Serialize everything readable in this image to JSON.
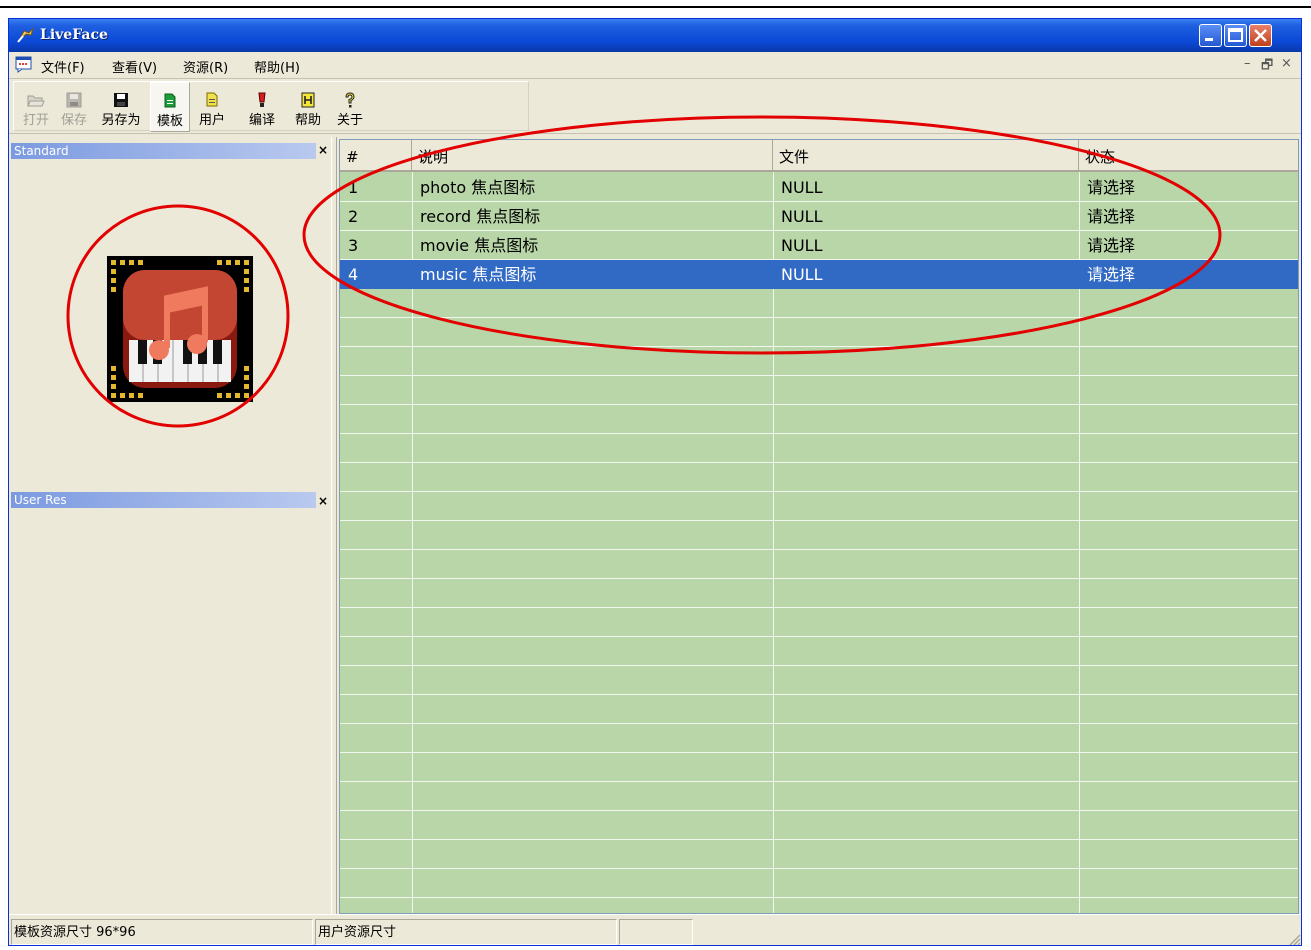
{
  "window": {
    "title": "LiveFace"
  },
  "menu": {
    "items": [
      "文件(F)",
      "查看(V)",
      "资源(R)",
      "帮助(H)"
    ]
  },
  "mdi": {
    "min": "–",
    "restore": "🗗",
    "close": "×"
  },
  "toolbar": {
    "buttons": [
      {
        "label": "打开",
        "icon": "open-folder-icon",
        "enabled": false
      },
      {
        "label": "保存",
        "icon": "save-disk-icon",
        "enabled": false
      },
      {
        "label": "另存为",
        "icon": "save-as-disk-icon",
        "enabled": true
      },
      {
        "label": "模板",
        "icon": "template-page-icon",
        "enabled": true,
        "pressed": true
      },
      {
        "label": "用户",
        "icon": "user-page-icon",
        "enabled": true
      },
      {
        "label": "编译",
        "icon": "compile-icon",
        "enabled": true
      },
      {
        "label": "帮助",
        "icon": "help-book-icon",
        "enabled": true
      },
      {
        "label": "关于",
        "icon": "about-question-icon",
        "enabled": true
      }
    ]
  },
  "panels": {
    "standard": {
      "title": "Standard",
      "close": "×"
    },
    "user_res": {
      "title": "User Res",
      "close": "×"
    }
  },
  "table": {
    "headers": [
      "#",
      "说明",
      "文件",
      "状态"
    ],
    "rows": [
      {
        "num": "1",
        "desc": "photo 焦点图标",
        "file": "NULL",
        "status": "请选择"
      },
      {
        "num": "2",
        "desc": "record 焦点图标",
        "file": "NULL",
        "status": "请选择"
      },
      {
        "num": "3",
        "desc": "movie 焦点图标",
        "file": "NULL",
        "status": "请选择"
      },
      {
        "num": "4",
        "desc": "music 焦点图标",
        "file": "NULL",
        "status": "请选择"
      }
    ],
    "selected_row": 4
  },
  "status": {
    "template_size": "模板资源尺寸 96*96",
    "user_size": "用户资源尺寸"
  },
  "colors": {
    "grid_bg": "#b8d6a8",
    "selection": "#316ac5",
    "annotation": "#e30000"
  }
}
